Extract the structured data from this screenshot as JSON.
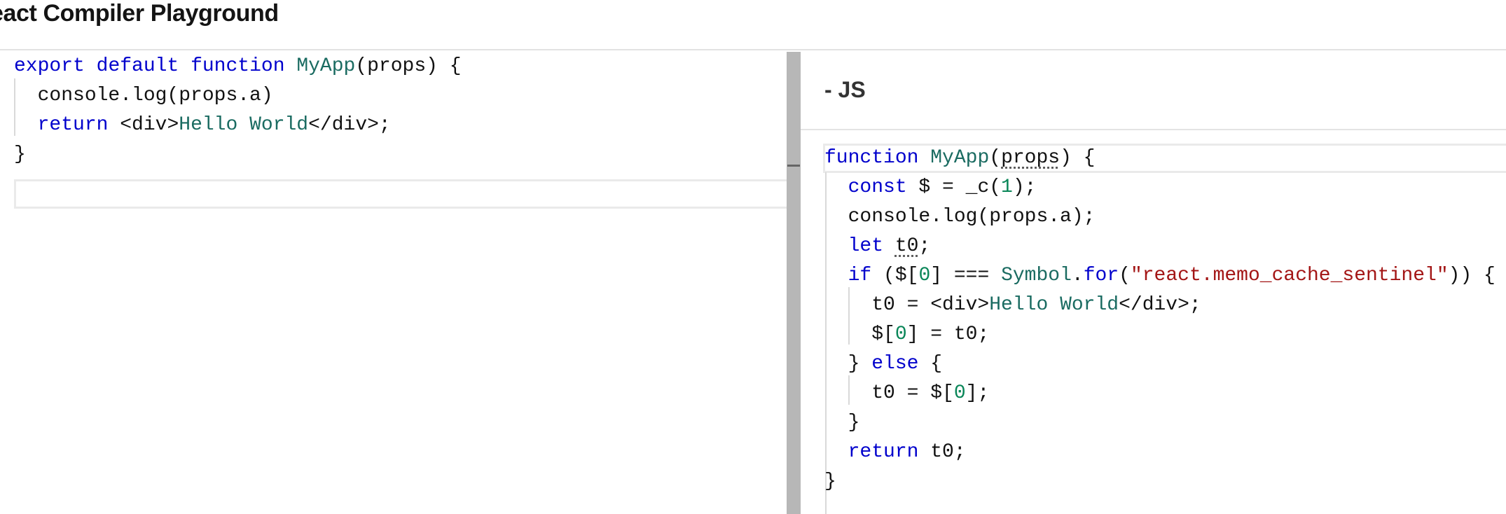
{
  "header": {
    "title": "eact Compiler Playground"
  },
  "left_editor": {
    "lines": [
      [
        {
          "t": "export",
          "c": "kw"
        },
        {
          "t": " "
        },
        {
          "t": "default",
          "c": "kw"
        },
        {
          "t": " "
        },
        {
          "t": "function",
          "c": "kw"
        },
        {
          "t": " "
        },
        {
          "t": "MyApp",
          "c": "fn"
        },
        {
          "t": "(props) {"
        }
      ],
      [
        {
          "t": "  console.log(props.a)"
        }
      ],
      [
        {
          "t": "  "
        },
        {
          "t": "return",
          "c": "kw"
        },
        {
          "t": " <div>"
        },
        {
          "t": "Hello World",
          "c": "jsx"
        },
        {
          "t": "</div>;"
        }
      ],
      [
        {
          "t": "}"
        }
      ]
    ]
  },
  "right_panel": {
    "tab_label": "- JS",
    "lines": [
      [
        {
          "t": "function",
          "c": "kw"
        },
        {
          "t": " "
        },
        {
          "t": "MyApp",
          "c": "fn"
        },
        {
          "t": "("
        },
        {
          "t": "props",
          "c": "squig"
        },
        {
          "t": ") {"
        }
      ],
      [
        {
          "t": "  "
        },
        {
          "t": "const",
          "c": "kw"
        },
        {
          "t": " $ = _c("
        },
        {
          "t": "1",
          "c": "num"
        },
        {
          "t": ");"
        }
      ],
      [
        {
          "t": "  console.log(props.a);"
        }
      ],
      [
        {
          "t": "  "
        },
        {
          "t": "let",
          "c": "kw"
        },
        {
          "t": " "
        },
        {
          "t": "t0",
          "c": "squig"
        },
        {
          "t": ";"
        }
      ],
      [
        {
          "t": "  "
        },
        {
          "t": "if",
          "c": "kw"
        },
        {
          "t": " ($["
        },
        {
          "t": "0",
          "c": "num"
        },
        {
          "t": "] === "
        },
        {
          "t": "Symbol",
          "c": "fn"
        },
        {
          "t": "."
        },
        {
          "t": "for",
          "c": "kw"
        },
        {
          "t": "("
        },
        {
          "t": "\"react.memo_cache_sentinel\"",
          "c": "str"
        },
        {
          "t": ")) {"
        }
      ],
      [
        {
          "t": "    t0 = <div>"
        },
        {
          "t": "Hello World",
          "c": "jsx"
        },
        {
          "t": "</div>;"
        }
      ],
      [
        {
          "t": "    $["
        },
        {
          "t": "0",
          "c": "num"
        },
        {
          "t": "] = t0;"
        }
      ],
      [
        {
          "t": "  } "
        },
        {
          "t": "else",
          "c": "kw"
        },
        {
          "t": " {"
        }
      ],
      [
        {
          "t": "    t0 = $["
        },
        {
          "t": "0",
          "c": "num"
        },
        {
          "t": "];"
        }
      ],
      [
        {
          "t": "  }"
        }
      ],
      [
        {
          "t": "  "
        },
        {
          "t": "return",
          "c": "kw"
        },
        {
          "t": " t0;"
        }
      ],
      [
        {
          "t": "}"
        }
      ]
    ]
  }
}
